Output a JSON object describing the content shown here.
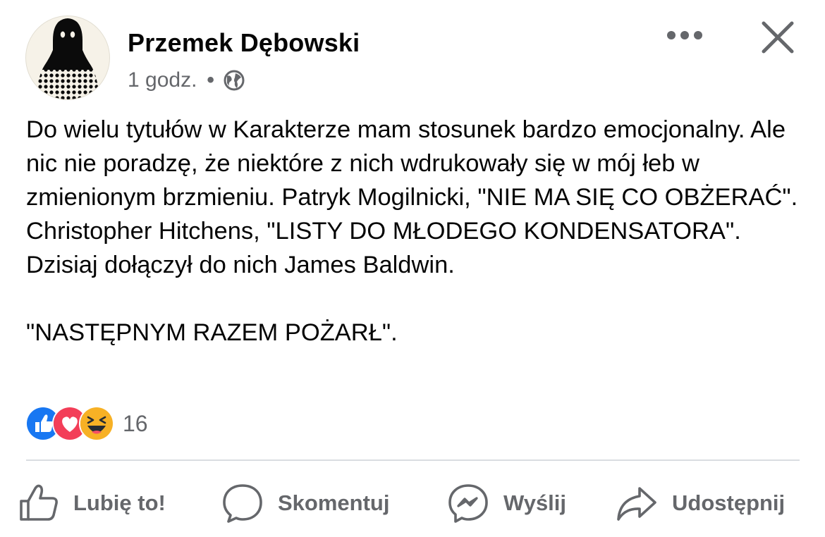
{
  "post": {
    "author": "Przemek Dębowski",
    "timestamp": "1 godz.",
    "separator": "•",
    "privacy_icon": "globe-icon",
    "body": {
      "paragraph1": "Do wielu tytułów w Karakterze mam stosunek bardzo emocjonalny. Ale nic nie poradzę, że niektóre z nich wdrukowały się w mój łeb w zmienionym brzmieniu. Patryk Mogilnicki, \"NIE MA SIĘ CO OBŻERAĆ\". Christopher Hitchens, \"LISTY DO MŁODEGO KONDENSATORA\". Dzisiaj dołączył do nich James Baldwin.",
      "paragraph2": "\"NASTĘPNYM RAZEM POŻARŁ\"."
    },
    "reactions": {
      "icons": [
        "like-reaction-icon",
        "love-reaction-icon",
        "haha-reaction-icon"
      ],
      "count": "16"
    }
  },
  "header_actions": {
    "more_icon": "ellipsis-icon",
    "close_icon": "close-icon"
  },
  "actions": {
    "like": "Lubię to!",
    "comment": "Skomentuj",
    "send": "Wyślij",
    "share": "Udostępnij"
  },
  "colors": {
    "text": "#050505",
    "secondary": "#65676b",
    "like_blue": "#1877f2",
    "love_red": "#f33e58",
    "haha_yellow": "#f7b125",
    "divider": "#dadde1"
  }
}
